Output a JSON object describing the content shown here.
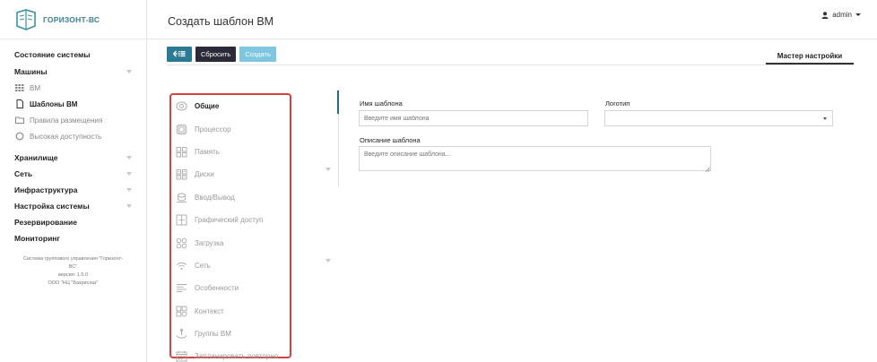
{
  "app": {
    "logo_text": "ГОРИЗОНТ-ВС"
  },
  "sidebar": {
    "items": [
      {
        "label": "Состояние системы"
      },
      {
        "label": "Машины"
      },
      {
        "label": "ВМ"
      },
      {
        "label": "Шаблоны ВМ"
      },
      {
        "label": "Правила размещения"
      },
      {
        "label": "Высокая доступность"
      },
      {
        "label": "Хранилище"
      },
      {
        "label": "Сеть"
      },
      {
        "label": "Инфраструктура"
      },
      {
        "label": "Настройка системы"
      },
      {
        "label": "Резервирование"
      },
      {
        "label": "Мониторинг"
      }
    ],
    "footer": {
      "line1": "Система группового управления \"Горизонт-",
      "line2": "ВС\"",
      "line3": "версия: 1.5.0",
      "line4": "ООО \"НЦ \"Базрисхаз\""
    }
  },
  "header": {
    "title": "Создать шаблон ВМ",
    "user": "admin"
  },
  "toolbar": {
    "back_icon": "back-list-icon",
    "reset_label": "Сбросить",
    "create_label": "Создать",
    "wizard_tab": "Мастер настройки"
  },
  "menu": {
    "items": [
      {
        "label": "Общие",
        "icon": "general-icon"
      },
      {
        "label": "Процессор",
        "icon": "cpu-icon"
      },
      {
        "label": "Память",
        "icon": "memory-icon"
      },
      {
        "label": "Диски",
        "icon": "disks-icon"
      },
      {
        "label": "Ввод/Вывод",
        "icon": "io-icon"
      },
      {
        "label": "Графический доступ",
        "icon": "graphics-icon"
      },
      {
        "label": "Загрузка",
        "icon": "boot-icon"
      },
      {
        "label": "Сеть",
        "icon": "network-icon"
      },
      {
        "label": "Особенности",
        "icon": "features-icon"
      },
      {
        "label": "Контекст",
        "icon": "context-icon"
      },
      {
        "label": "Группы ВМ",
        "icon": "vm-groups-icon"
      },
      {
        "label": "Запланировать повторно",
        "icon": "schedule-icon"
      }
    ]
  },
  "form": {
    "name_label": "Имя шаблона",
    "name_placeholder": "Введите имя шаблона",
    "logo_label": "Логотип",
    "logo_value": "",
    "description_label": "Описание шаблона",
    "description_placeholder": "Введите описание шаблона..."
  },
  "colors": {
    "accent": "#2b7a94",
    "dark_button": "#2a2a38",
    "create_button": "#7fc6e0",
    "highlight_border": "#d9413f"
  }
}
